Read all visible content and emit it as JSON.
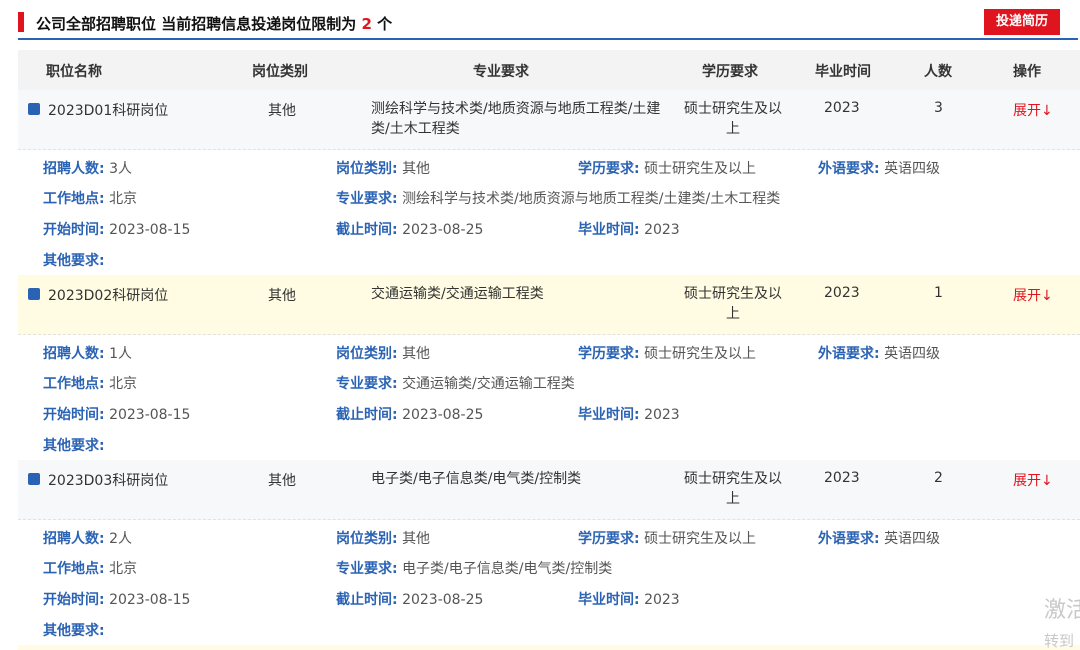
{
  "header": {
    "title_prefix": "公司全部招聘职位 当前招聘信息投递岗位限制为 ",
    "limit": "2",
    "title_suffix": " 个",
    "submit_label": "投递简历",
    "accent_color": "#e0141e",
    "link_color": "#2b63b4"
  },
  "columns": [
    "职位名称",
    "岗位类别",
    "专业要求",
    "学历要求",
    "毕业时间",
    "人数",
    "操作"
  ],
  "jobs": [
    {
      "name": "2023D01科研岗位",
      "category": "其他",
      "major": "测绘科学与技术类/地质资源与地质工程类/土建类/土木工程类",
      "education": "硕士研究生及以上",
      "grad": "2023",
      "count": "3",
      "action": "展开↓",
      "details": {
        "recruit_label": "招聘人数:",
        "recruit": "3人",
        "cat_label": "岗位类别:",
        "cat": "其他",
        "edu_label": "学历要求:",
        "edu": "硕士研究生及以上",
        "lang_label": "外语要求:",
        "lang": "英语四级",
        "loc_label": "工作地点:",
        "loc": "北京",
        "major_label": "专业要求:",
        "major": "测绘科学与技术类/地质资源与地质工程类/土建类/土木工程类",
        "start_label": "开始时间:",
        "start": "2023-08-15",
        "end_label": "截止时间:",
        "end": "2023-08-25",
        "grad_label": "毕业时间:",
        "grad": "2023",
        "other_label": "其他要求:"
      }
    },
    {
      "name": "2023D02科研岗位",
      "category": "其他",
      "major": "交通运输类/交通运输工程类",
      "education": "硕士研究生及以上",
      "grad": "2023",
      "count": "1",
      "action": "展开↓",
      "details": {
        "recruit_label": "招聘人数:",
        "recruit": "1人",
        "cat_label": "岗位类别:",
        "cat": "其他",
        "edu_label": "学历要求:",
        "edu": "硕士研究生及以上",
        "lang_label": "外语要求:",
        "lang": "英语四级",
        "loc_label": "工作地点:",
        "loc": "北京",
        "major_label": "专业要求:",
        "major": "交通运输类/交通运输工程类",
        "start_label": "开始时间:",
        "start": "2023-08-15",
        "end_label": "截止时间:",
        "end": "2023-08-25",
        "grad_label": "毕业时间:",
        "grad": "2023",
        "other_label": "其他要求:"
      }
    },
    {
      "name": "2023D03科研岗位",
      "category": "其他",
      "major": "电子类/电子信息类/电气类/控制类",
      "education": "硕士研究生及以上",
      "grad": "2023",
      "count": "2",
      "action": "展开↓",
      "details": {
        "recruit_label": "招聘人数:",
        "recruit": "2人",
        "cat_label": "岗位类别:",
        "cat": "其他",
        "edu_label": "学历要求:",
        "edu": "硕士研究生及以上",
        "lang_label": "外语要求:",
        "lang": "英语四级",
        "loc_label": "工作地点:",
        "loc": "北京",
        "major_label": "专业要求:",
        "major": "电子类/电子信息类/电气类/控制类",
        "start_label": "开始时间:",
        "start": "2023-08-15",
        "end_label": "截止时间:",
        "end": "2023-08-25",
        "grad_label": "毕业时间:",
        "grad": "2023",
        "other_label": "其他要求:"
      }
    }
  ],
  "watermark": {
    "line1": "激活",
    "line2": "转到"
  }
}
